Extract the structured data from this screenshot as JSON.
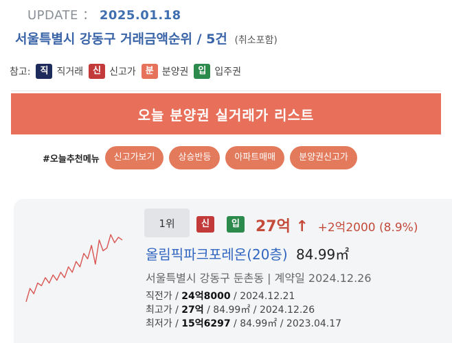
{
  "header": {
    "update_label": "UPDATE",
    "update_sep": "：",
    "update_date": "2025.01.18",
    "title_main": "서울특별시 강동구 거래금액순위 /  5건",
    "title_sub": "(취소포함)"
  },
  "legend": {
    "label": "참고:",
    "items": [
      {
        "badge": "직",
        "text": "직거래",
        "color": "#1f2a5c"
      },
      {
        "badge": "신",
        "text": "신고가",
        "color": "#c23a3a"
      },
      {
        "badge": "분",
        "text": "분양권",
        "color": "#e7725a"
      },
      {
        "badge": "입",
        "text": "입주권",
        "color": "#2c8a4c"
      }
    ]
  },
  "banner": {
    "text": "오늘 분양권 실거래가 리스트",
    "color": "#e8705a"
  },
  "menu": {
    "label": "#오늘추천메뉴",
    "items": [
      "신고가보기",
      "상승반등",
      "아파트매매",
      "분양권신고가"
    ]
  },
  "listing": {
    "rank": "1위",
    "badges": [
      {
        "text": "신",
        "color": "#c23a3a"
      },
      {
        "text": "입",
        "color": "#2c8a4c"
      }
    ],
    "price": "27억 ↑",
    "change": "+2억2000 (8.9%)",
    "name": "올림픽파크포레온(20층)",
    "area": "84.99㎡",
    "address": "서울특별시 강동구 둔촌동 | 계약일 2024.12.26",
    "rows": [
      {
        "label": "직전가 / ",
        "value": "24억8000",
        "rest": " / 2024.12.21"
      },
      {
        "label": "최고가 / ",
        "value": "27억",
        "rest": " / 84.99㎡ / 2024.12.26"
      },
      {
        "label": "최저가 / ",
        "value": "15억6297",
        "rest": " / 84.99㎡ / 2023.04.17"
      }
    ],
    "trend_values": [
      2,
      7,
      5,
      9,
      8,
      11,
      9,
      12,
      10,
      13,
      11,
      15,
      13,
      17,
      15,
      20,
      18,
      23,
      16,
      25,
      21,
      22,
      27,
      24,
      26,
      25
    ]
  }
}
